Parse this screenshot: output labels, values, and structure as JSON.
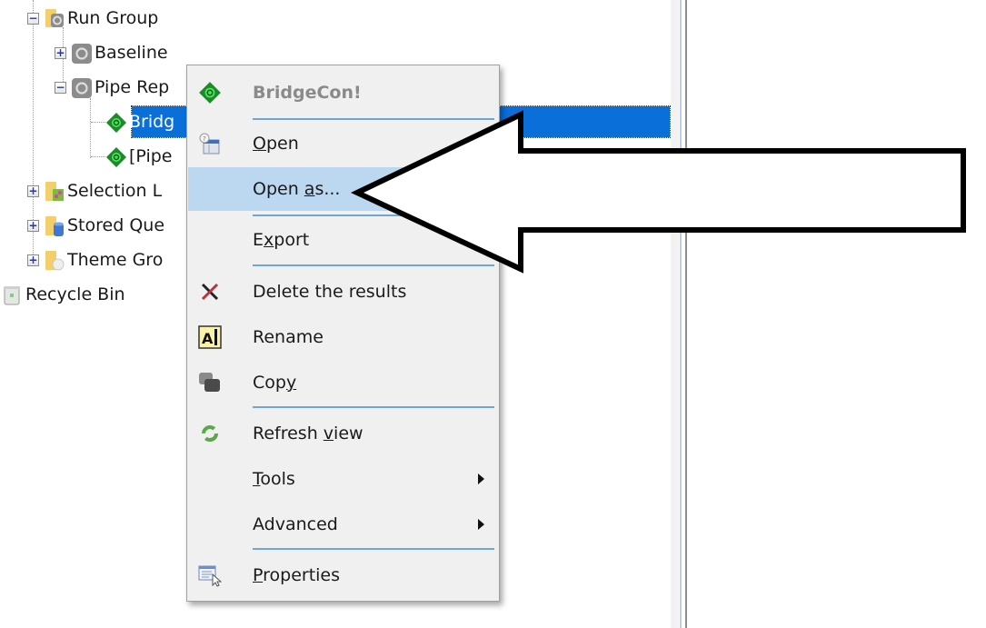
{
  "tree": {
    "nodes": [
      {
        "label": "Run Group",
        "icon": "run-group-folder-icon",
        "expander": "minus"
      },
      {
        "label": "Baseline",
        "icon": "run-icon",
        "expander": "plus"
      },
      {
        "label": "Pipe Rep",
        "icon": "run-icon",
        "expander": "minus"
      },
      {
        "label": "Bridg",
        "icon": "result-diamond-icon",
        "selected": true
      },
      {
        "label": "[Pipe",
        "icon": "result-diamond-icon"
      },
      {
        "label": "Selection L",
        "icon": "selection-folder-icon",
        "expander": "plus"
      },
      {
        "label": "Stored Que",
        "icon": "stored-query-folder-icon",
        "expander": "plus"
      },
      {
        "label": "Theme Gro",
        "icon": "theme-folder-icon",
        "expander": "plus"
      },
      {
        "label": "Recycle Bin",
        "icon": "recycle-bin-icon"
      }
    ]
  },
  "context_menu": {
    "header": {
      "label": "BridgeCon!",
      "icon": "result-diamond-icon"
    },
    "items": [
      {
        "id": "open",
        "pre": "",
        "key": "O",
        "post": "pen",
        "icon": "open-icon"
      },
      {
        "id": "open-as",
        "pre": "Open ",
        "key": "a",
        "post": "s...",
        "highlighted": true
      },
      {
        "id": "export",
        "pre": "E",
        "key": "x",
        "post": "port"
      },
      {
        "id": "delete",
        "pre": "Delete the results",
        "key": "",
        "post": "",
        "icon": "delete-x-icon"
      },
      {
        "id": "rename",
        "pre": "Rename",
        "key": "",
        "post": "",
        "icon": "rename-icon"
      },
      {
        "id": "copy",
        "pre": "Cop",
        "key": "y",
        "post": "",
        "icon": "copy-icon"
      },
      {
        "id": "refresh",
        "pre": "Refresh ",
        "key": "v",
        "post": "iew",
        "icon": "refresh-icon"
      },
      {
        "id": "tools",
        "pre": "",
        "key": "T",
        "post": "ools",
        "submenu": true
      },
      {
        "id": "advanced",
        "pre": "Advanced",
        "key": "",
        "post": "",
        "submenu": true
      },
      {
        "id": "properties",
        "pre": "",
        "key": "P",
        "post": "roperties",
        "icon": "properties-icon"
      }
    ]
  },
  "annotation": {
    "type": "callout-arrow",
    "points_to": "Open as..."
  },
  "colors": {
    "selection": "#0a6fd8",
    "menu_highlight": "#bcd8f1",
    "separator": "#6da7d7"
  }
}
